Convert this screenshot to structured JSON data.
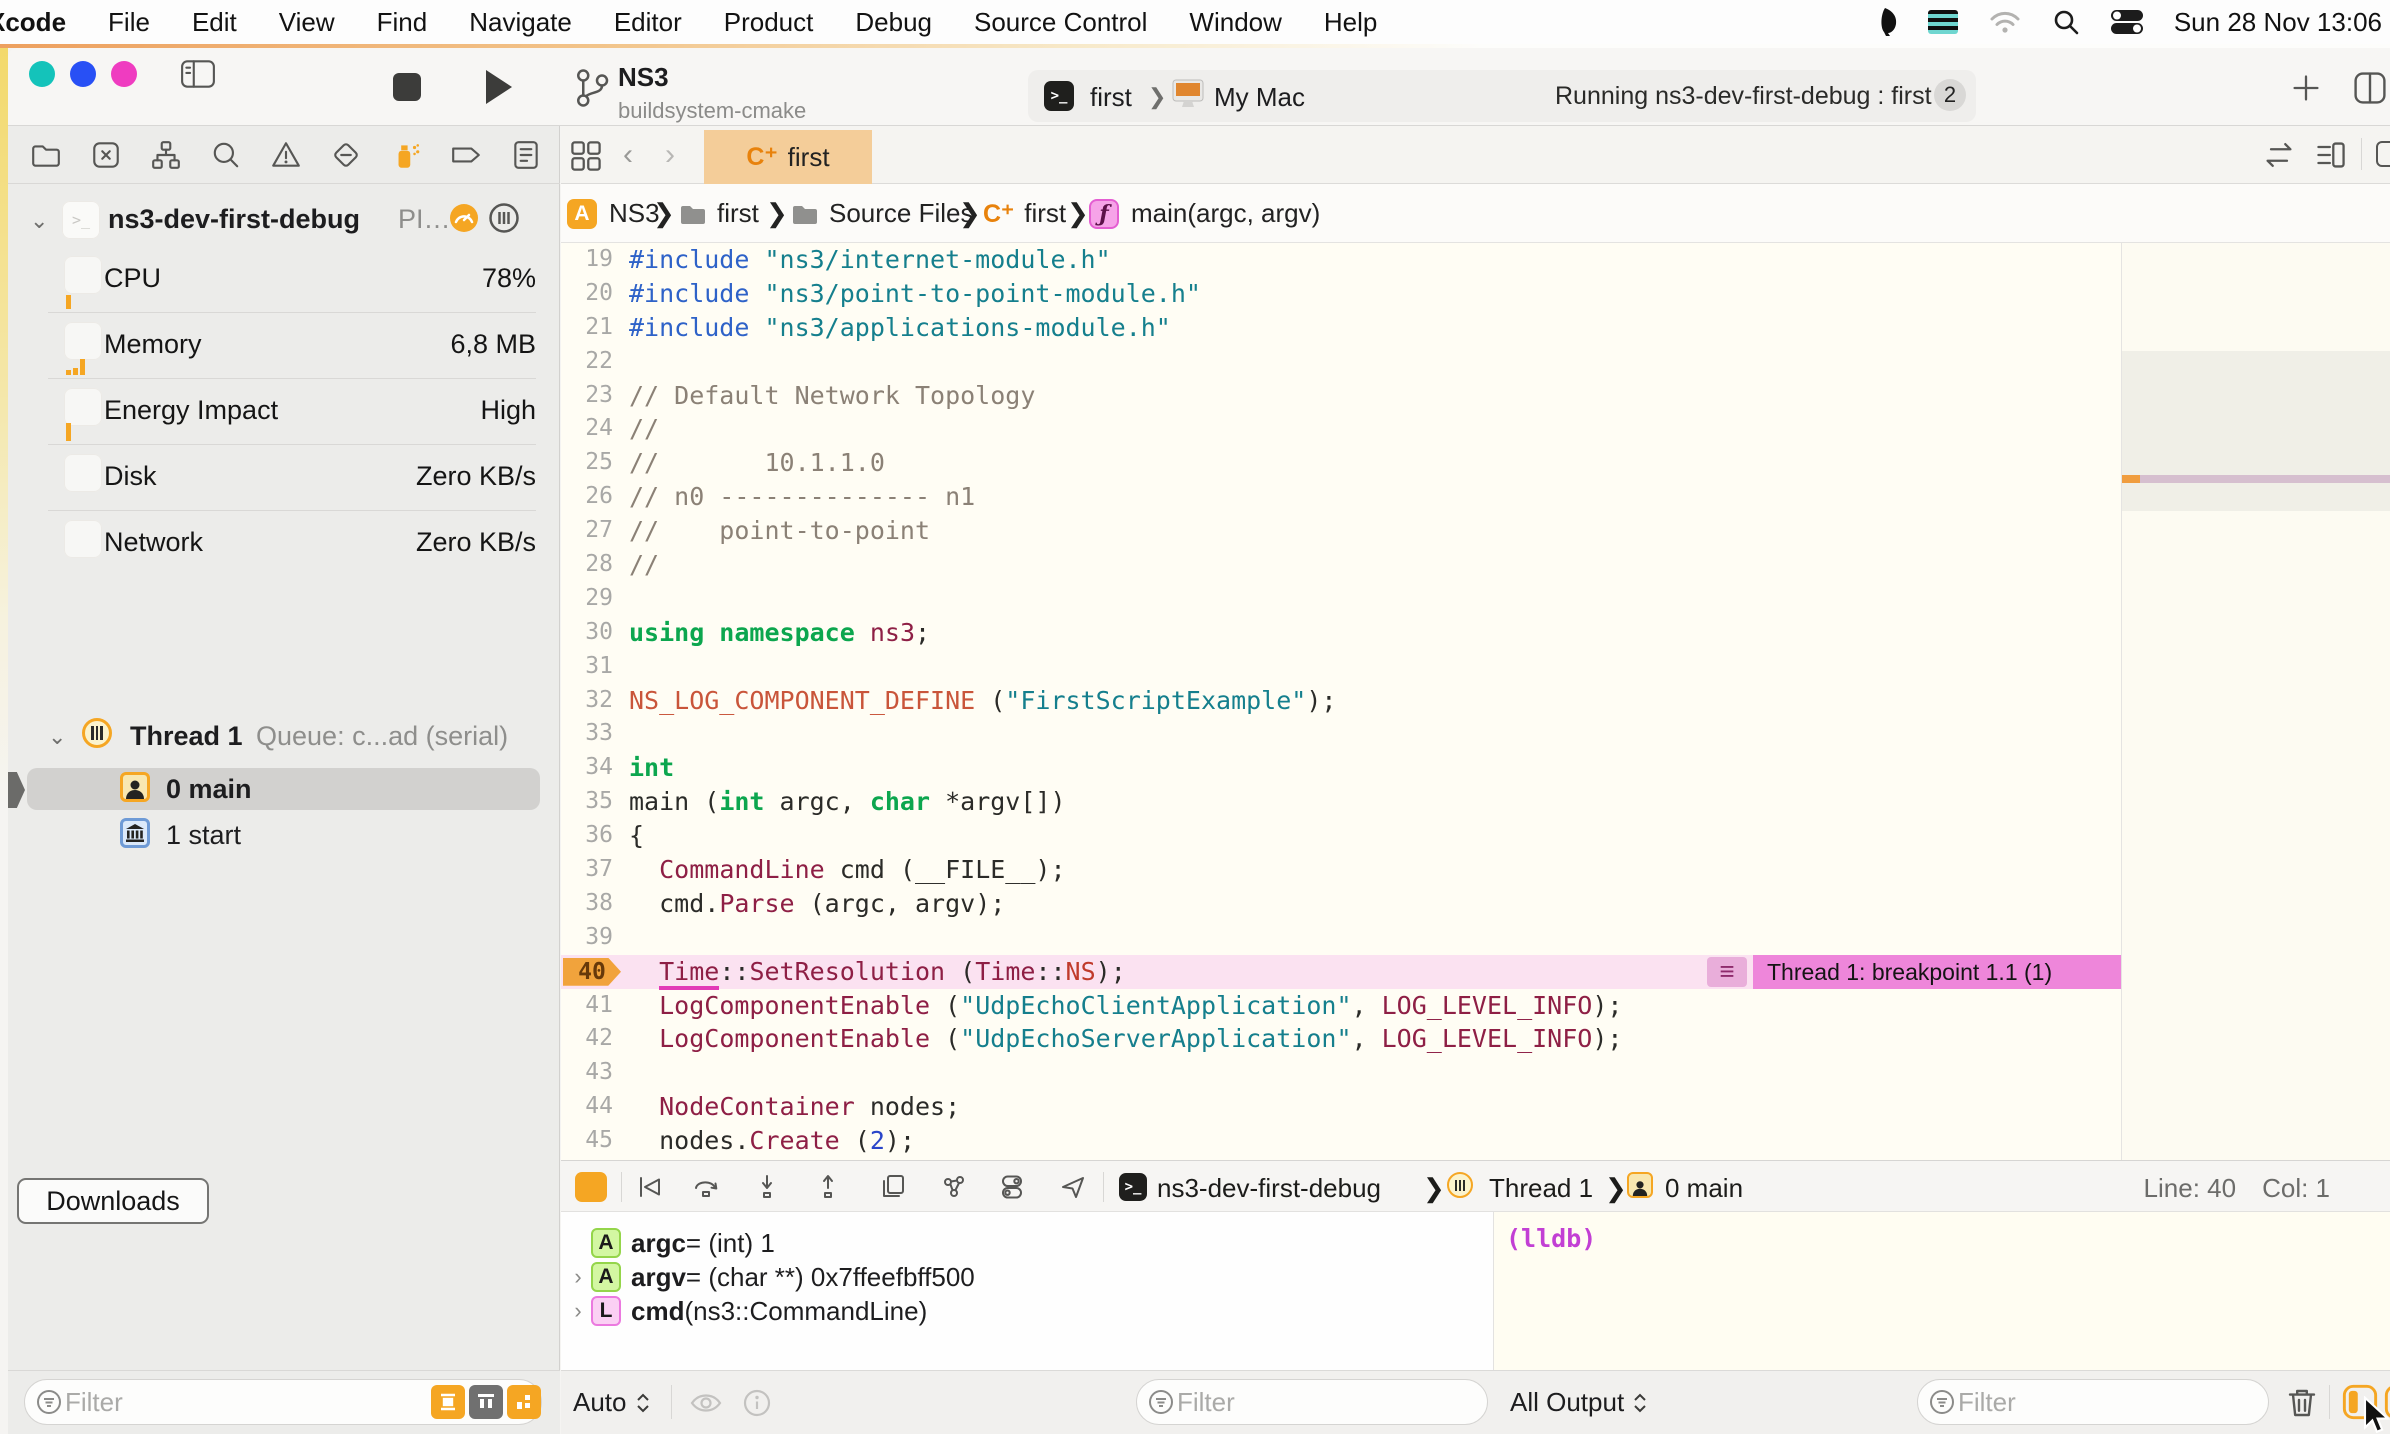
{
  "menubar": {
    "app": "Xcode",
    "items": [
      "File",
      "Edit",
      "View",
      "Find",
      "Navigate",
      "Editor",
      "Product",
      "Debug",
      "Source Control",
      "Window",
      "Help"
    ],
    "clock": "Sun 28 Nov 13:06"
  },
  "toolbar": {
    "project": "NS3",
    "project_sub": "buildsystem-cmake",
    "scheme": "first",
    "destination": "My Mac",
    "status": "Running ns3-dev-first-debug : first",
    "status_count": "2"
  },
  "navigator": {
    "process_name": "ns3-dev-first-debug",
    "process_meta": "PI…",
    "stats": [
      {
        "icon": "cpu-icon",
        "label": "CPU",
        "value": "78%"
      },
      {
        "icon": "memory-icon",
        "label": "Memory",
        "value": "6,8 MB"
      },
      {
        "icon": "energy-icon",
        "label": "Energy Impact",
        "value": "High"
      },
      {
        "icon": "disk-icon",
        "label": "Disk",
        "value": "Zero KB/s"
      },
      {
        "icon": "network-icon",
        "label": "Network",
        "value": "Zero KB/s"
      }
    ],
    "thread_name": "Thread 1",
    "thread_queue": "Queue: c...ad (serial)",
    "frames": [
      {
        "label": "0 main"
      },
      {
        "label": "1 start"
      }
    ],
    "downloads_button": "Downloads",
    "filter_placeholder": "Filter"
  },
  "editor": {
    "tab_label": "first",
    "cpp_badge": "C⁺",
    "breadcrumb": {
      "project": "NS3",
      "group1": "first",
      "group2": "Source Files",
      "file": "first",
      "symbol": "main(argc, argv)"
    },
    "breakpoint_label": "Thread 1: breakpoint 1.1 (1)",
    "code": [
      {
        "n": "19",
        "seg": [
          [
            "pre",
            "#include "
          ],
          [
            "str",
            "\"ns3/internet-module.h\""
          ]
        ]
      },
      {
        "n": "20",
        "seg": [
          [
            "pre",
            "#include "
          ],
          [
            "str",
            "\"ns3/point-to-point-module.h\""
          ]
        ]
      },
      {
        "n": "21",
        "seg": [
          [
            "pre",
            "#include "
          ],
          [
            "str",
            "\"ns3/applications-module.h\""
          ]
        ]
      },
      {
        "n": "22",
        "seg": []
      },
      {
        "n": "23",
        "seg": [
          [
            "com",
            "// Default Network Topology"
          ]
        ]
      },
      {
        "n": "24",
        "seg": [
          [
            "com",
            "//"
          ]
        ]
      },
      {
        "n": "25",
        "seg": [
          [
            "com",
            "//       10.1.1.0"
          ]
        ]
      },
      {
        "n": "26",
        "seg": [
          [
            "com",
            "// n0 -------------- n1"
          ]
        ]
      },
      {
        "n": "27",
        "seg": [
          [
            "com",
            "//    point-to-point"
          ]
        ]
      },
      {
        "n": "28",
        "seg": [
          [
            "com",
            "//"
          ]
        ]
      },
      {
        "n": "29",
        "seg": []
      },
      {
        "n": "30",
        "seg": [
          [
            "kw",
            "using namespace"
          ],
          [
            "pl",
            " "
          ],
          [
            "type",
            "ns3"
          ],
          [
            "pl",
            ";"
          ]
        ]
      },
      {
        "n": "31",
        "seg": []
      },
      {
        "n": "32",
        "seg": [
          [
            "macro",
            "NS_LOG_COMPONENT_DEFINE"
          ],
          [
            "pl",
            " ("
          ],
          [
            "str",
            "\"FirstScriptExample\""
          ],
          [
            "pl",
            ");"
          ]
        ]
      },
      {
        "n": "33",
        "seg": []
      },
      {
        "n": "34",
        "seg": [
          [
            "kw",
            "int"
          ]
        ]
      },
      {
        "n": "35",
        "seg": [
          [
            "pl",
            "main ("
          ],
          [
            "kw",
            "int"
          ],
          [
            "pl",
            " argc, "
          ],
          [
            "kw",
            "char"
          ],
          [
            "pl",
            " *argv[])"
          ]
        ]
      },
      {
        "n": "36",
        "seg": [
          [
            "pl",
            "{"
          ]
        ]
      },
      {
        "n": "37",
        "seg": [
          [
            "pl",
            "  "
          ],
          [
            "type",
            "CommandLine"
          ],
          [
            "pl",
            " cmd (__FILE__);"
          ]
        ]
      },
      {
        "n": "38",
        "seg": [
          [
            "pl",
            "  cmd."
          ],
          [
            "type",
            "Parse"
          ],
          [
            "pl",
            " (argc, argv);"
          ]
        ]
      },
      {
        "n": "39",
        "seg": []
      },
      {
        "n": "40",
        "bp": true,
        "seg": [
          [
            "pl",
            "  "
          ],
          [
            "typeu",
            "Time"
          ],
          [
            "pl",
            "::"
          ],
          [
            "type",
            "SetResolution"
          ],
          [
            "pl",
            " ("
          ],
          [
            "type",
            "Time"
          ],
          [
            "pl",
            "::"
          ],
          [
            "en",
            "NS"
          ],
          [
            "pl",
            ");"
          ]
        ]
      },
      {
        "n": "41",
        "seg": [
          [
            "pl",
            "  "
          ],
          [
            "type",
            "LogComponentEnable"
          ],
          [
            "pl",
            " ("
          ],
          [
            "str",
            "\"UdpEchoClientApplication\""
          ],
          [
            "pl",
            ", "
          ],
          [
            "type",
            "LOG_LEVEL_INFO"
          ],
          [
            "pl",
            ");"
          ]
        ]
      },
      {
        "n": "42",
        "seg": [
          [
            "pl",
            "  "
          ],
          [
            "type",
            "LogComponentEnable"
          ],
          [
            "pl",
            " ("
          ],
          [
            "str",
            "\"UdpEchoServerApplication\""
          ],
          [
            "pl",
            ", "
          ],
          [
            "type",
            "LOG_LEVEL_INFO"
          ],
          [
            "pl",
            ");"
          ]
        ]
      },
      {
        "n": "43",
        "seg": []
      },
      {
        "n": "44",
        "seg": [
          [
            "pl",
            "  "
          ],
          [
            "type",
            "NodeContainer"
          ],
          [
            "pl",
            " nodes;"
          ]
        ]
      },
      {
        "n": "45",
        "seg": [
          [
            "pl",
            "  nodes."
          ],
          [
            "type",
            "Create"
          ],
          [
            "pl",
            " ("
          ],
          [
            "num",
            "2"
          ],
          [
            "pl",
            ");"
          ]
        ]
      }
    ]
  },
  "debugbar": {
    "process": "ns3-dev-first-debug",
    "thread": "Thread 1",
    "frame": "0 main",
    "line_label": "Line: 40",
    "col_label": "Col: 1"
  },
  "variables": {
    "scope": "Auto",
    "filter_placeholder": "Filter",
    "rows": [
      {
        "badge": "A",
        "name": "argc",
        "rest": " = (int) 1"
      },
      {
        "badge": "A",
        "name": "argv",
        "rest": " = (char **) 0x7ffeefbff500"
      },
      {
        "badge": "L",
        "name": "cmd",
        "rest": " (ns3::CommandLine)"
      }
    ]
  },
  "console": {
    "prompt": "(lldb)",
    "output_mode": "All Output",
    "filter_placeholder": "Filter"
  },
  "colors": {
    "accent_orange": "#f5a623",
    "breakpoint_pink": "#ee86da",
    "traffic_1": "#14c3ba",
    "traffic_2": "#2850f5",
    "traffic_3": "#ef3cc0"
  }
}
